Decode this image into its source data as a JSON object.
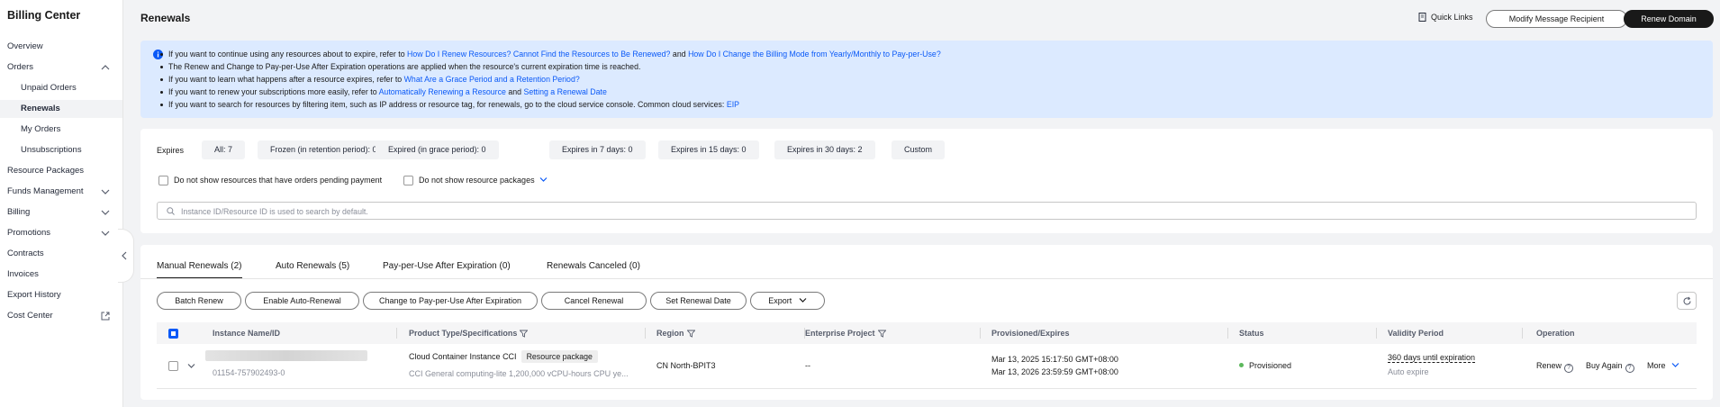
{
  "sidebar": {
    "title": "Billing Center",
    "items": [
      {
        "label": "Overview"
      },
      {
        "label": "Orders"
      },
      {
        "label": "Unpaid Orders"
      },
      {
        "label": "Renewals"
      },
      {
        "label": "My Orders"
      },
      {
        "label": "Unsubscriptions"
      },
      {
        "label": "Resource Packages"
      },
      {
        "label": "Funds Management"
      },
      {
        "label": "Billing"
      },
      {
        "label": "Promotions"
      },
      {
        "label": "Contracts"
      },
      {
        "label": "Invoices"
      },
      {
        "label": "Export History"
      },
      {
        "label": "Cost Center"
      }
    ]
  },
  "header": {
    "title": "Renewals",
    "quick_links": "Quick Links",
    "modify_recipient": "Modify Message Recipient",
    "renew_domain": "Renew Domain"
  },
  "notice": {
    "line1": {
      "text": "If you want to continue using any resources about to expire, refer to",
      "link1": "How Do I Renew Resources? Cannot Find the Resources to Be Renewed?",
      "and": "and",
      "link2": "How Do I Change the Billing Mode from Yearly/Monthly to Pay-per-Use?"
    },
    "line2": "The Renew and Change to Pay-per-Use After Expiration operations are applied when the resource's current expiration time is reached.",
    "line3": {
      "text": "If you want to learn what happens after a resource expires, refer to",
      "link": "What Are a Grace Period and a Retention Period?"
    },
    "line4": {
      "text": "If you want to renew your subscriptions more easily, refer to",
      "link1": "Automatically Renewing a Resource",
      "and": "and",
      "link2": "Setting a Renewal Date"
    },
    "line5": {
      "text": "If you want to search for resources by filtering item, such as IP address or resource tag, for renewals, go to the cloud service console. Common cloud services:",
      "link": "EIP"
    }
  },
  "filters": {
    "expires_label": "Expires",
    "chips": [
      "All: 7",
      "Frozen (in retention period): 0",
      "Expired (in grace period): 0",
      "Expires in 7 days: 0",
      "Expires in 15 days: 0",
      "Expires in 30 days: 2",
      "Custom"
    ],
    "hide_pending": "Do not show resources that have orders pending payment",
    "hide_packages": "Do not show resource packages",
    "search_placeholder": "Instance ID/Resource ID is used to search by default."
  },
  "tabs": [
    "Manual Renewals (2)",
    "Auto Renewals (5)",
    "Pay-per-Use After Expiration (0)",
    "Renewals Canceled (0)"
  ],
  "actions": {
    "batch_renew": "Batch Renew",
    "enable_auto": "Enable Auto-Renewal",
    "change_ppu": "Change to Pay-per-Use After Expiration",
    "cancel_renewal": "Cancel Renewal",
    "set_date": "Set Renewal Date",
    "export": "Export"
  },
  "table": {
    "columns": [
      "Instance Name/ID",
      "Product Type/Specifications",
      "Region",
      "Enterprise Project",
      "Provisioned/Expires",
      "Status",
      "Validity Period",
      "Operation"
    ],
    "rows": [
      {
        "instance_id": "01154-757902493-0",
        "product": "Cloud Container Instance CCI",
        "badge": "Resource package",
        "spec": "CCI General computing-lite 1,200,000 vCPU-hours CPU ye...",
        "region": "CN North-BPIT3",
        "enterprise_project": "--",
        "provisioned": "Mar 13, 2025 15:17:50 GMT+08:00",
        "expires": "Mar 13, 2026 23:59:59 GMT+08:00",
        "status": "Provisioned",
        "validity": "360 days until expiration",
        "renew_type": "Auto expire",
        "op_renew": "Renew",
        "op_buy_again": "Buy Again",
        "op_more": "More"
      }
    ]
  },
  "colors": {
    "link": "#0a59f7",
    "notice_bg": "#dceaff",
    "status_ok": "#5cb85c",
    "primary_dark": "#191919"
  }
}
